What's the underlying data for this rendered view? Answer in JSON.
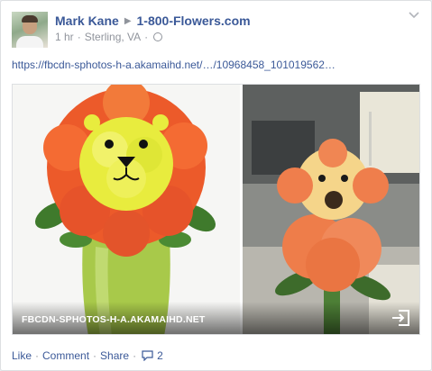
{
  "post": {
    "author": "Mark Kane",
    "target": "1-800-Flowers.com",
    "time": "1 hr",
    "location": "Sterling, VA",
    "link_url": "https://fbcdn-sphotos-h-a.akamaihd.net/…/10968458_101019562…",
    "caption": "FBCDN-SPHOTOS-H-A.AKAMAIHD.NET",
    "icons": {
      "audience": "globe-icon",
      "options": "chevron-down-icon",
      "share_link": "open-link-icon",
      "comments": "comment-bubble-icon"
    }
  },
  "actions": {
    "like": "Like",
    "comment": "Comment",
    "share": "Share",
    "comment_count": "2"
  },
  "colors": {
    "link": "#3b5998",
    "meta": "#90949c",
    "border": "#dddfe2"
  }
}
